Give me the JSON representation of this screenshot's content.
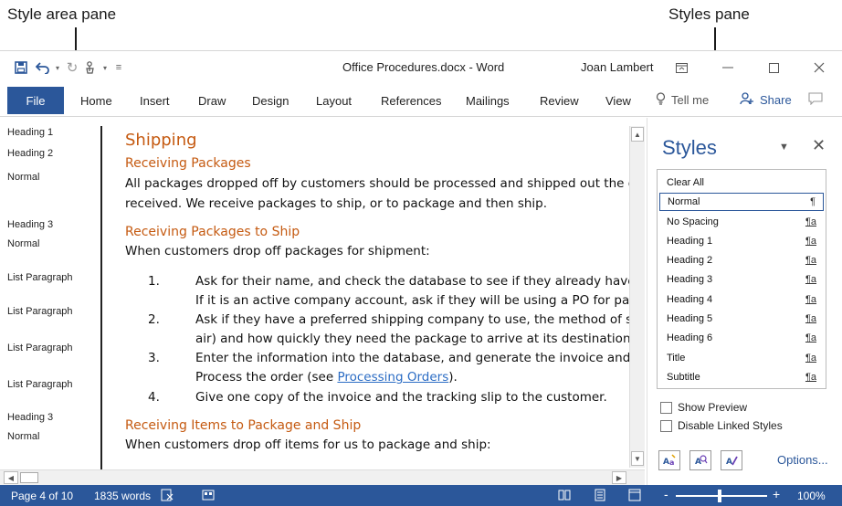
{
  "callouts": {
    "style_area": "Style area pane",
    "styles_pane": "Styles pane"
  },
  "titlebar": {
    "doc_title": "Office Procedures.docx  -  Word",
    "user": "Joan Lambert",
    "qat_icons": [
      "save-icon",
      "undo-icon",
      "redo-icon",
      "touch-mode-icon",
      "customize-qat-icon"
    ]
  },
  "ribbon": {
    "file": "File",
    "tabs": [
      "Home",
      "Insert",
      "Draw",
      "Design",
      "Layout",
      "References",
      "Mailings",
      "Review",
      "View"
    ],
    "tell_me": "Tell me",
    "share": "Share"
  },
  "style_area": {
    "items": [
      "Heading 1",
      "Heading 2",
      "Normal",
      "Heading 3",
      "Normal",
      "List Paragraph",
      "List Paragraph",
      "List Paragraph",
      "List Paragraph",
      "Heading 3",
      "Normal"
    ]
  },
  "document": {
    "h1": "Shipping",
    "h2_1": "Receiving Packages",
    "p1_line1": "All packages dropped off by customers should be processed and shipped out the day",
    "p1_line2": "received. We receive packages to ship, or to package and then ship.",
    "h3_1": "Receiving Packages to Ship",
    "p2": "When customers drop off packages for shipment:",
    "list": [
      {
        "num": "1.",
        "line1": "Ask for their name, and check the database to see if they already have a",
        "line2": "If it is an active company account, ask if they will be using a PO for payme"
      },
      {
        "num": "2.",
        "line1": "Ask if they have a preferred shipping company to use, the method of shi",
        "line2": "air) and how quickly they need the package to arrive at its destination."
      },
      {
        "num": "3.",
        "line1": "Enter the information into the database, and generate the invoice and tr",
        "line2_prefix": "Process the order (see ",
        "line2_link": "Processing Orders",
        "line2_suffix": ")."
      },
      {
        "num": "4.",
        "line1": "Give one copy of the invoice and the tracking slip to the customer."
      }
    ],
    "h3_2": "Receiving Items to Package and Ship",
    "p3": "When customers drop off items for us to package and ship:"
  },
  "styles_pane": {
    "title": "Styles",
    "items": [
      {
        "label": "Clear All",
        "mark": ""
      },
      {
        "label": "Normal",
        "mark": "¶",
        "selected": true
      },
      {
        "label": "No Spacing",
        "mark": "¶a"
      },
      {
        "label": "Heading 1",
        "mark": "¶a"
      },
      {
        "label": "Heading 2",
        "mark": "¶a"
      },
      {
        "label": "Heading 3",
        "mark": "¶a"
      },
      {
        "label": "Heading 4",
        "mark": "¶a"
      },
      {
        "label": "Heading 5",
        "mark": "¶a"
      },
      {
        "label": "Heading 6",
        "mark": "¶a"
      },
      {
        "label": "Title",
        "mark": "¶a"
      },
      {
        "label": "Subtitle",
        "mark": "¶a"
      }
    ],
    "show_preview": "Show Preview",
    "disable_linked": "Disable Linked Styles",
    "options": "Options...",
    "buttons": [
      "new-style-icon",
      "style-inspector-icon",
      "manage-styles-icon"
    ]
  },
  "statusbar": {
    "page": "Page 4 of 10",
    "words": "1835 words",
    "zoom": "100%",
    "zoom_minus": "-",
    "zoom_plus": "+"
  },
  "colors": {
    "accent": "#2b579a",
    "heading": "#c55a11",
    "link": "#2b6cc4"
  }
}
